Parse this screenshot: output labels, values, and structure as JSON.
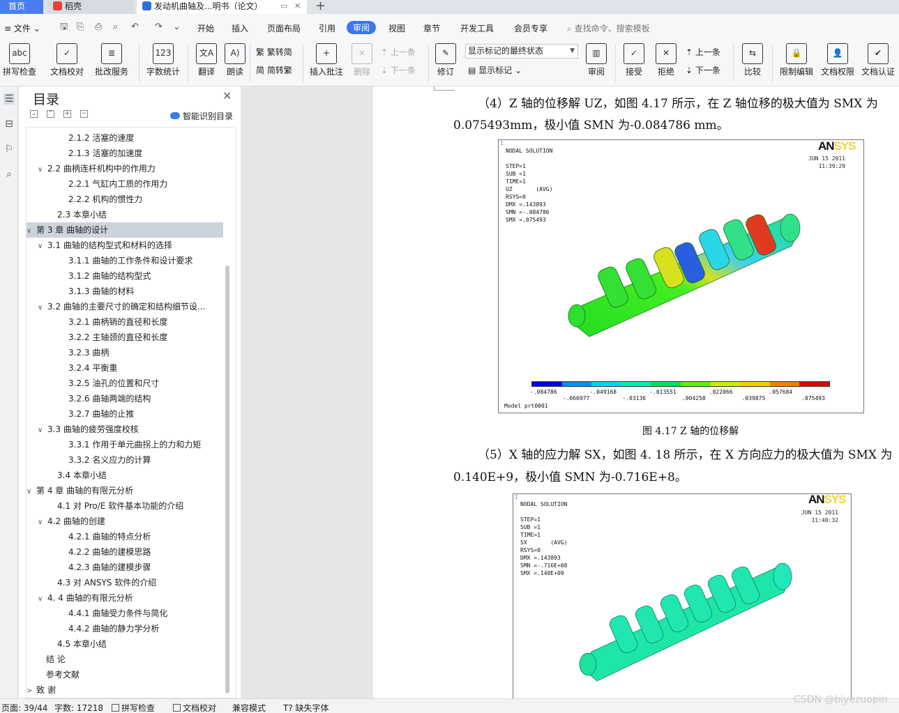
{
  "tabs": {
    "home": "首页",
    "daoke": "稻壳",
    "doc": "发动机曲轴及...明书（论文）",
    "new_tab": "+"
  },
  "menu": {
    "file": "文件",
    "items": [
      "开始",
      "插入",
      "页面布局",
      "引用",
      "审阅",
      "视图",
      "章节",
      "开发工具",
      "会员专享"
    ],
    "active_item": "审阅",
    "search": "查找命令、搜索模板"
  },
  "ribbon": {
    "spell_check": "拼写检查",
    "doc_proof": "文档校对",
    "batch_service": "批改服务",
    "word_count": "字数统计",
    "translate": "翻译",
    "read_aloud": "朗读",
    "to_traditional": "繁转简",
    "to_simplified": "简转繁",
    "insert_comment": "插入批注",
    "delete": "删除",
    "prev_comment": "上一条",
    "next_comment": "下一条",
    "track_changes": "修订",
    "display_select": "显示标记的最终状态",
    "show_markup": "显示标记",
    "review": "审阅",
    "accept": "接受",
    "reject": "拒绝",
    "prev_change": "上一条",
    "next_change": "下一条",
    "compare": "比较",
    "restrict_edit": "限制编辑",
    "doc_permission": "文档权限",
    "doc_auth": "文档认证"
  },
  "toc": {
    "title": "目录",
    "smart": "智能识别目录",
    "items": [
      {
        "text": "2.1.2  活塞的速度",
        "level": 3,
        "chev": ""
      },
      {
        "text": "2.1.3  活塞的加速度",
        "level": 3,
        "chev": ""
      },
      {
        "text": "2.2  曲柄连杆机构中的作用力",
        "level": 2,
        "chev": "∨"
      },
      {
        "text": "2.2.1  气缸内工质的作用力",
        "level": 3,
        "chev": ""
      },
      {
        "text": "2.2.2  机构的惯性力",
        "level": 3,
        "chev": ""
      },
      {
        "text": "2.3  本章小结",
        "level": 2,
        "chev": ""
      },
      {
        "text": "第 3 章  曲轴的设计",
        "level": 1,
        "chev": "∨",
        "selected": true
      },
      {
        "text": "3.1  曲轴的结构型式和材料的选择",
        "level": 2,
        "chev": "∨"
      },
      {
        "text": "3.1.1  曲轴的工作条件和设计要求",
        "level": 3,
        "chev": ""
      },
      {
        "text": "3.1.2  曲轴的结构型式",
        "level": 3,
        "chev": ""
      },
      {
        "text": "3.1.3  曲轴的材料",
        "level": 3,
        "chev": ""
      },
      {
        "text": "3.2  曲轴的主要尺寸的确定和结构细节设...",
        "level": 2,
        "chev": "∨"
      },
      {
        "text": "3.2.1  曲柄销的直径和长度",
        "level": 3,
        "chev": ""
      },
      {
        "text": "3.2.2  主轴颈的直径和长度",
        "level": 3,
        "chev": ""
      },
      {
        "text": "3.2.3  曲柄",
        "level": 3,
        "chev": ""
      },
      {
        "text": "3.2.4  平衡重",
        "level": 3,
        "chev": ""
      },
      {
        "text": "3.2.5  油孔的位置和尺寸",
        "level": 3,
        "chev": ""
      },
      {
        "text": "3.2.6  曲轴两端的结构",
        "level": 3,
        "chev": ""
      },
      {
        "text": "3.2.7  曲轴的止推",
        "level": 3,
        "chev": ""
      },
      {
        "text": "3.3  曲轴的疲劳强度校核",
        "level": 2,
        "chev": "∨"
      },
      {
        "text": "3.3.1  作用于单元曲拐上的力和力矩",
        "level": 3,
        "chev": ""
      },
      {
        "text": "3.3.2  名义应力的计算",
        "level": 3,
        "chev": ""
      },
      {
        "text": "3.4  本章小结",
        "level": 2,
        "chev": ""
      },
      {
        "text": "第 4 章  曲轴的有限元分析",
        "level": 1,
        "chev": "∨"
      },
      {
        "text": "4.1  对 Pro/E 软件基本功能的介绍",
        "level": 2,
        "chev": ""
      },
      {
        "text": "4.2  曲轴的创建",
        "level": 2,
        "chev": "∨"
      },
      {
        "text": "4.2.1  曲轴的特点分析",
        "level": 3,
        "chev": ""
      },
      {
        "text": "4.2.2  曲轴的建模思路",
        "level": 3,
        "chev": ""
      },
      {
        "text": "4.2.3  曲轴的建模步骤",
        "level": 3,
        "chev": ""
      },
      {
        "text": "4.3  对 ANSYS 软件的介绍",
        "level": 2,
        "chev": ""
      },
      {
        "text": "4. 4  曲轴的有限元分析",
        "level": 2,
        "chev": "∨"
      },
      {
        "text": "4.4.1  曲轴受力条件与简化",
        "level": 3,
        "chev": ""
      },
      {
        "text": "4.4.2  曲轴的静力学分析",
        "level": 3,
        "chev": ""
      },
      {
        "text": "4.5  本章小结",
        "level": 2,
        "chev": ""
      },
      {
        "text": "结      论",
        "level": 1,
        "chev": ""
      },
      {
        "text": "参考文献",
        "level": 1,
        "chev": ""
      },
      {
        "text": "致      谢",
        "level": 1,
        "chev": ">"
      }
    ]
  },
  "doc": {
    "para1_line1": "（4）Z 轴的位移解 UZ，如图 4.17 所示，在 Z 轴位移的极大值为 SMX 为",
    "para1_line2": "0.075493mm，极小值 SMN 为-0.084786 mm。",
    "fig1_caption": "图 4.17 Z 轴的位移解",
    "para2_line1": "（5）X 轴的应力解 SX，如图 4. 18 所示，在 X 方向应力的极大值为 SMX 为",
    "para2_line2": "0.140E+9，极小值 SMN 为-0.716E+8。",
    "fig1": {
      "header": "NODAL SOLUTION\n\nSTEP=1\nSUB =1\nTIME=1\nUZ       (AVG)\nRSYS=0\nDMX =.143893\nSMN =-.084786\nSMX =.075493",
      "logo_a": "AN",
      "logo_s": "SYS",
      "date": "JUN 15 2011\n11:39:29",
      "legend_top": [
        "-.084786",
        "-.049168",
        "-.013551",
        ".022066",
        ".057684"
      ],
      "legend_bottom": [
        "-.066977",
        "-.03136",
        ".004258",
        ".039875",
        ".075493"
      ],
      "model": "Model prt0001",
      "marker": "1"
    },
    "fig2": {
      "header": "NODAL SOLUTION\n\nSTEP=1\nSUB =1\nTIME=1\nSX       (AVG)\nRSYS=0\nDMX =.143893\nSMN =-.716E+08\nSMX =.140E+09",
      "logo_a": "AN",
      "logo_s": "SYS",
      "date": "JUN 15 2011\n11:40:32",
      "marker": "1"
    },
    "legend_colors": [
      "#0000e0",
      "#0090f0",
      "#00d8f0",
      "#00f0b0",
      "#00e060",
      "#60f000",
      "#c8f000",
      "#f0d000",
      "#f08000",
      "#e00000"
    ]
  },
  "status": {
    "page": "页面: 39/44",
    "words": "字数: 17218",
    "spell": "拼写检查",
    "proof": "文档校对",
    "compat": "兼容模式",
    "missing_font": "缺失字体"
  },
  "watermark": "CSDN @biyezuopin"
}
